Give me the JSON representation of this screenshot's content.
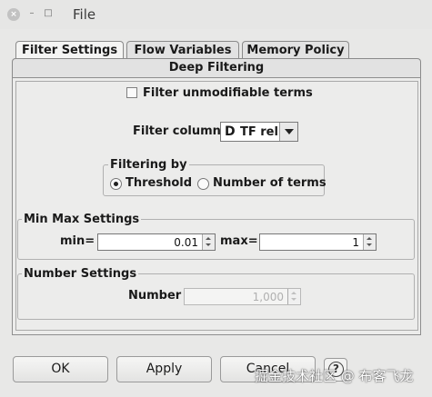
{
  "window": {
    "title": "File",
    "close_glyph": "×",
    "minimize_glyph": "–",
    "maximize_glyph": "□"
  },
  "tabs": {
    "row1": [
      "Filter Settings",
      "Flow Variables",
      "Memory Policy"
    ],
    "row2": [
      "Deep Filtering"
    ],
    "active": "Filter Settings"
  },
  "filter_unmodifiable": {
    "label": "Filter unmodifiable terms",
    "checked": false
  },
  "filter_column": {
    "label": "Filter column",
    "type_glyph": "D",
    "value": "TF rel"
  },
  "filtering_by": {
    "title": "Filtering by",
    "options": [
      "Threshold",
      "Number of terms"
    ],
    "selected": "Threshold"
  },
  "min_max": {
    "title": "Min Max Settings",
    "min_label": "min=",
    "min_value": "0.01",
    "max_label": "max=",
    "max_value": "1"
  },
  "number_settings": {
    "title": "Number Settings",
    "number_label": "Number",
    "number_value": "1,000",
    "enabled": false
  },
  "buttons": {
    "ok": "OK",
    "apply": "Apply",
    "cancel": "Cancel",
    "help_glyph": "?"
  },
  "watermark": "掘金技术社区 @ 布客飞龙"
}
